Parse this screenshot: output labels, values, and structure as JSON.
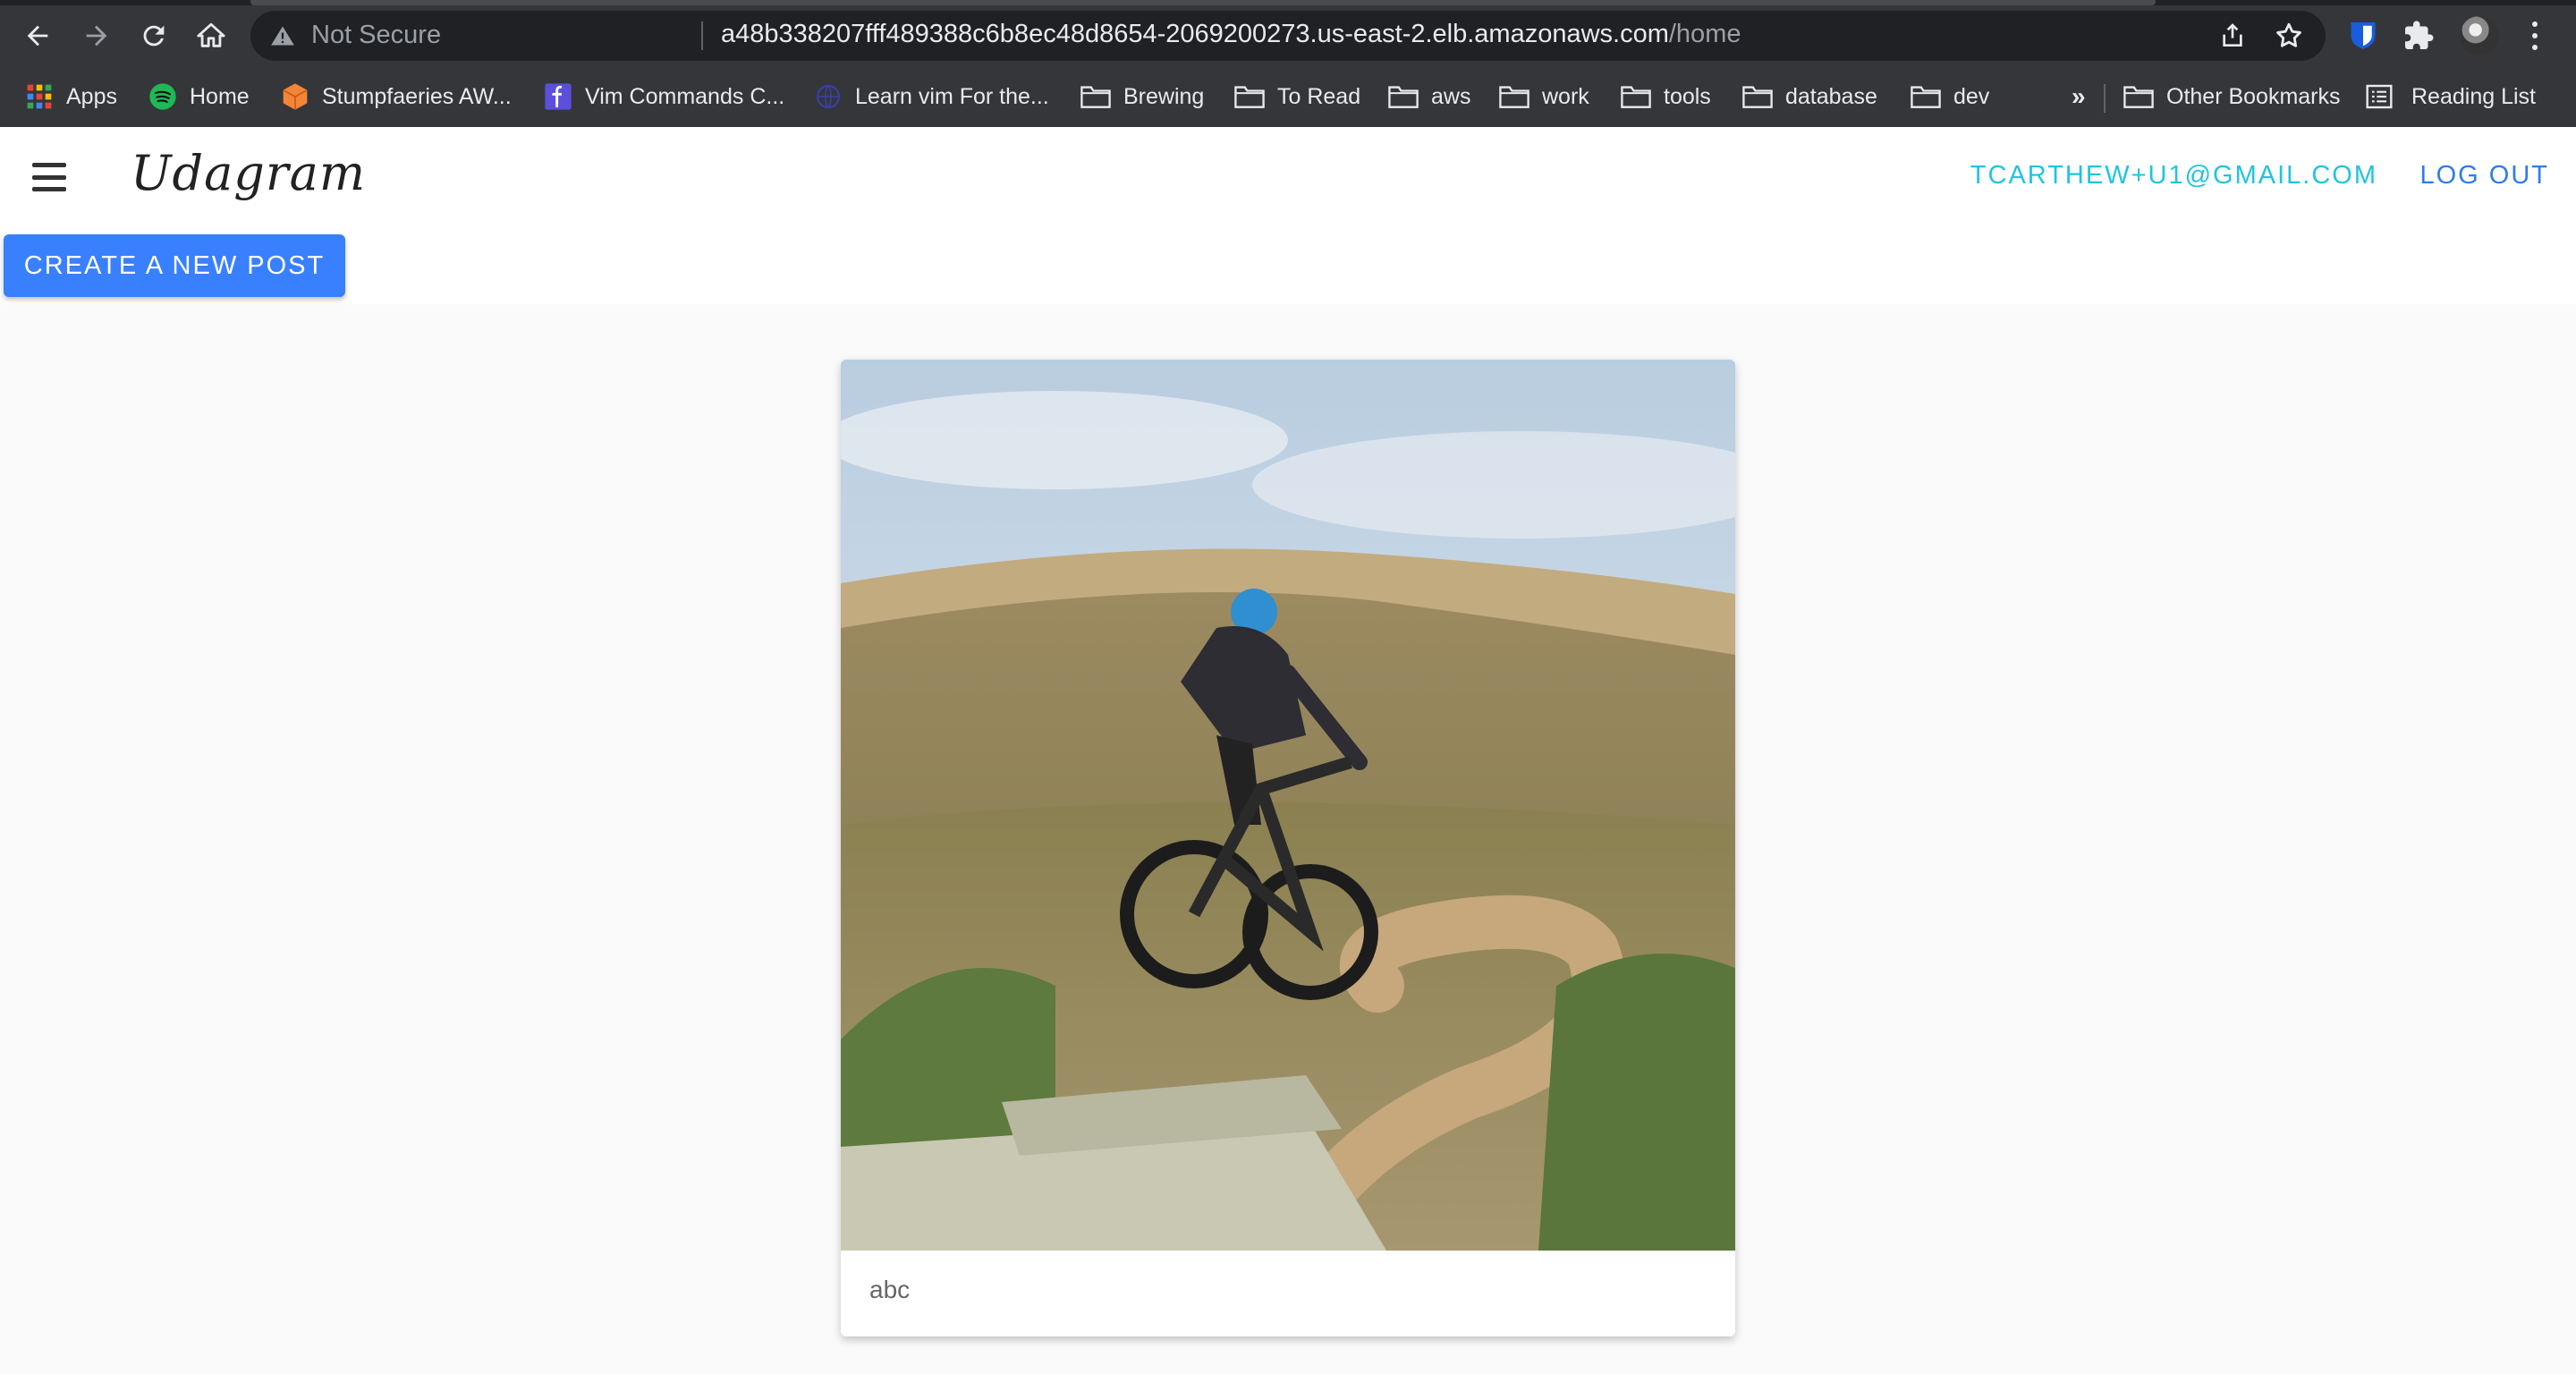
{
  "browser": {
    "omnibox": {
      "security_label": "Not Secure",
      "url_host": "a48b338207fff489388c6b8ec48d8654-2069200273.us-east-2.elb.amazonaws.com",
      "url_path": "/home"
    },
    "bookmarks": [
      {
        "label": "Apps",
        "icon": "apps-grid-icon"
      },
      {
        "label": "Home",
        "icon": "spotify-icon"
      },
      {
        "label": "Stumpfaeries AW...",
        "icon": "aws-cube-icon"
      },
      {
        "label": "Vim Commands C...",
        "icon": "vim-icon"
      },
      {
        "label": "Learn vim For the...",
        "icon": "globe-icon"
      },
      {
        "label": "Brewing",
        "icon": "folder-icon"
      },
      {
        "label": "To Read",
        "icon": "folder-icon"
      },
      {
        "label": "aws",
        "icon": "folder-icon"
      },
      {
        "label": "work",
        "icon": "folder-icon"
      },
      {
        "label": "tools",
        "icon": "folder-icon"
      },
      {
        "label": "database",
        "icon": "folder-icon"
      },
      {
        "label": "dev",
        "icon": "folder-icon"
      }
    ],
    "overflow_chevron": "»",
    "other_bookmarks": "Other Bookmarks",
    "reading_list": "Reading List"
  },
  "app": {
    "brand": "Udagram",
    "user_email": "TCARTHEW+U1@GMAIL.COM",
    "logout_label": "LOG OUT",
    "create_post_label": "CREATE A NEW POST",
    "accent_color": "#3880ff",
    "email_color": "#20c4e0"
  },
  "feed": {
    "posts": [
      {
        "caption": "abc"
      }
    ]
  }
}
